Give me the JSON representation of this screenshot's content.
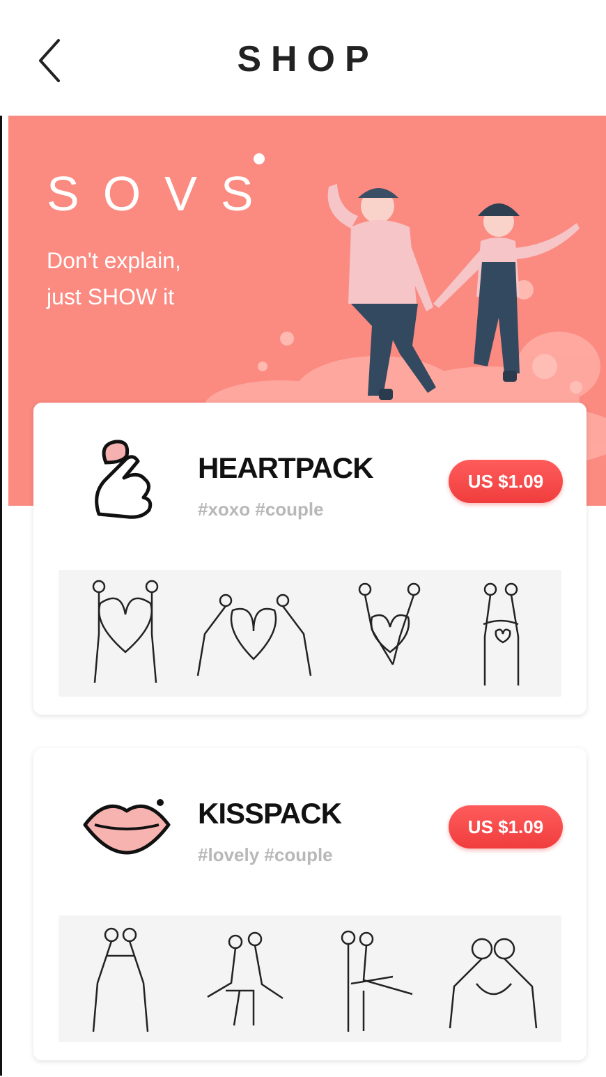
{
  "header": {
    "title": "SHOP"
  },
  "banner": {
    "logo": "SOVS",
    "tagline_line1": "Don't explain,",
    "tagline_line2": "just SHOW it"
  },
  "packs": [
    {
      "name": "HEARTPACK",
      "tags": "#xoxo #couple",
      "price": "US $1.09",
      "icon": "finger-heart-icon"
    },
    {
      "name": "KISSPACK",
      "tags": "#lovely #couple",
      "price": "US $1.09",
      "icon": "lips-icon"
    }
  ],
  "colors": {
    "banner": "#fb8a80",
    "price": "#f04545",
    "tags": "#b8b8b8"
  }
}
